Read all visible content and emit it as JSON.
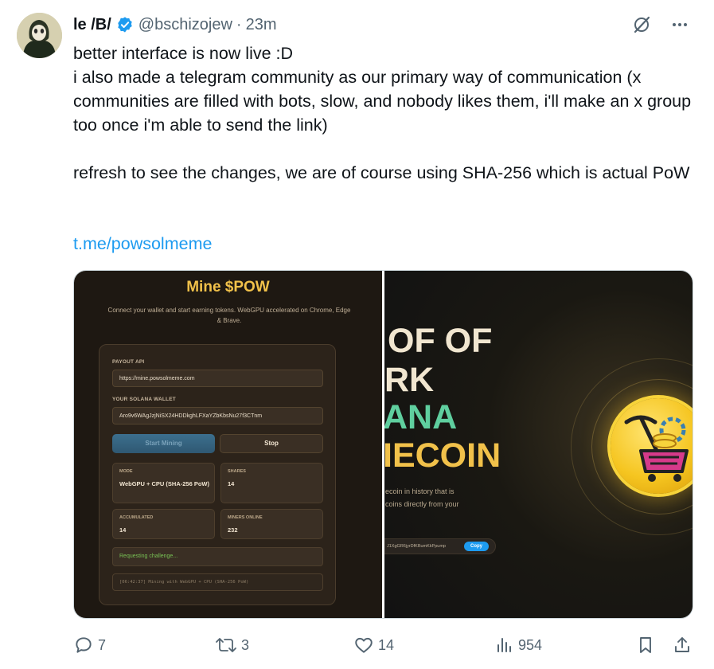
{
  "author": {
    "display_name": "le /B/",
    "handle": "@bschizojew",
    "separator": "·",
    "time": "23m"
  },
  "tweet": {
    "text": "better interface is now live :D\ni also made a telegram community as our primary way of communication (x communities are filled with bots, slow, and nobody likes them, i'll make an x group too once i'm able to send the link)\n\nrefresh to see the changes, we are of course using SHA-256 which is actual PoW",
    "link": "t.me/powsolmeme"
  },
  "media_left": {
    "title": "Mine $POW",
    "subtitle": "Connect your wallet and start earning tokens. WebGPU accelerated on Chrome, Edge & Brave.",
    "payout_label": "PAYOUT API",
    "payout_value": "https://mine.powsolmeme.com",
    "wallet_label": "YOUR SOLANA WALLET",
    "wallet_value": "Aro9v6WAgJzjNiSX24HDDkghLFXaYZbKbsNu27f3CTnm",
    "start_label": "Start Mining",
    "stop_label": "Stop",
    "stats": [
      {
        "label": "MODE",
        "value": "WebGPU + CPU (SHA-256 PoW)"
      },
      {
        "label": "SHARES",
        "value": "14"
      },
      {
        "label": "ACCUMULATED",
        "value": "14"
      },
      {
        "label": "MINERS ONLINE",
        "value": "232"
      }
    ],
    "status": "Requesting challenge...",
    "log": "[06:42:37] Mining with WebGPU + CPU (SHA-256 PoW)"
  },
  "media_right": {
    "lines": [
      "OF OF",
      "RK",
      "ANA",
      "IECOIN"
    ],
    "line_colors": [
      "#f1e6d0",
      "#f1e6d0",
      "#5fcf9f",
      "#f1c14a"
    ],
    "desc1": "ecoin in history that is",
    "desc2": "coins directly from your",
    "address": "J1XgGR6jyrDfKBumKkPpump",
    "copy_label": "Copy"
  },
  "actions": {
    "replies": "7",
    "retweets": "3",
    "likes": "14",
    "views": "954"
  },
  "colors": {
    "accent": "#1d9bf0",
    "muted": "#536471",
    "gold": "#f1c14a"
  },
  "icons": [
    "verified-badge-icon",
    "grok-icon",
    "more-icon",
    "reply-icon",
    "retweet-icon",
    "like-icon",
    "views-icon",
    "bookmark-icon",
    "share-icon"
  ]
}
